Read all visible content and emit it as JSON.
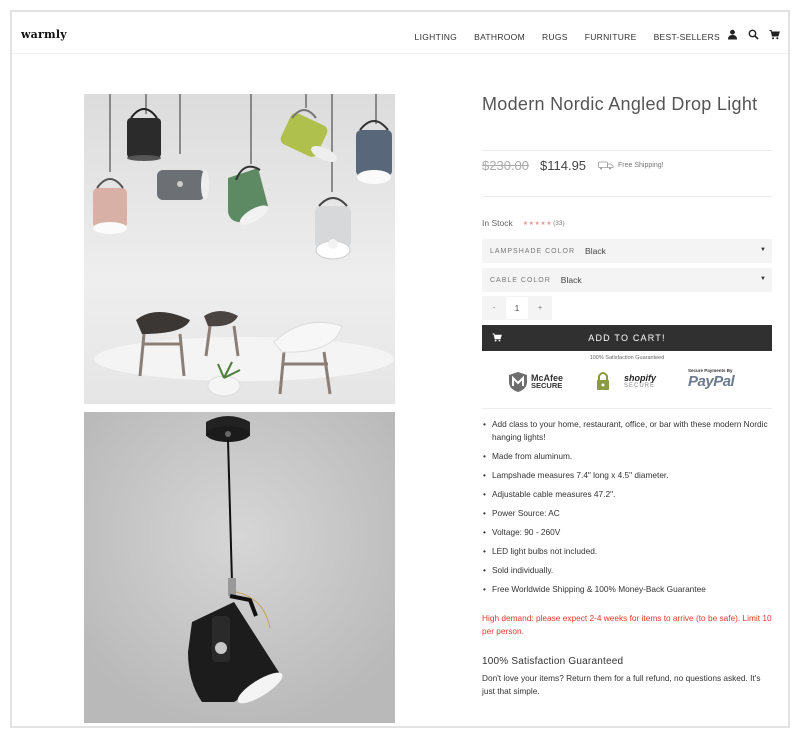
{
  "brand": {
    "logo": "warmly"
  },
  "nav": {
    "items": [
      "LIGHTING",
      "BATHROOM",
      "RUGS",
      "FURNITURE",
      "BEST-SELLERS"
    ],
    "icons": [
      "user-icon",
      "search-icon",
      "cart-icon"
    ]
  },
  "product": {
    "title": "Modern Nordic Angled Drop Light",
    "old_price": "$230.00",
    "price": "$114.95",
    "shipping": "Free Shipping!",
    "stock": "In Stock",
    "rating_stars": "★★★★★",
    "rating": 5,
    "review_count": "(33)",
    "options": [
      {
        "label": "LAMPSHADE COLOR",
        "value": "Black"
      },
      {
        "label": "CABLE COLOR",
        "value": "Black"
      }
    ],
    "quantity": {
      "minus": "-",
      "value": "1",
      "plus": "+"
    },
    "add_to_cart": "ADD TO CART!",
    "guarantee_note": "100% Satisfaction Guaranteed",
    "badges": {
      "mcafee_line1": "McAfee",
      "mcafee_line2": "SECURE",
      "shopify_line1": "shopify",
      "shopify_line2": "SECURE",
      "paypal_top": "Secure Payments By",
      "paypal": "PayPal"
    },
    "features": [
      "Add class to your home, restaurant, office, or bar with these modern Nordic hanging lights!",
      "Made from aluminum.",
      "Lampshade measures 7.4\" long x 4.5\" diameter.",
      "Adjustable cable measures 47.2\".",
      "Power Source: AC",
      "Voltage: 90 - 260V",
      "LED light bulbs not included.",
      "Sold individually.",
      "Free Worldwide Shipping & 100% Money-Back Guarantee"
    ],
    "demand_notice": "High demand: please expect 2-4 weeks for items to arrive (to be safe). Limit 10 per person.",
    "satisfaction_title": "100% Satisfaction Guaranteed",
    "satisfaction_body": "Don't love your items? Return them for a full refund, no questions asked. It's just that simple."
  },
  "colors": {
    "button_bg": "#303030",
    "demand_text": "#e03b2a",
    "star_color": "#e39a9a",
    "lamp_colors": [
      "#2b2b2b",
      "#b0c04d",
      "#58687a",
      "#d9b0a5",
      "#6c7074",
      "#5d8a63",
      "#d6d8da"
    ]
  }
}
